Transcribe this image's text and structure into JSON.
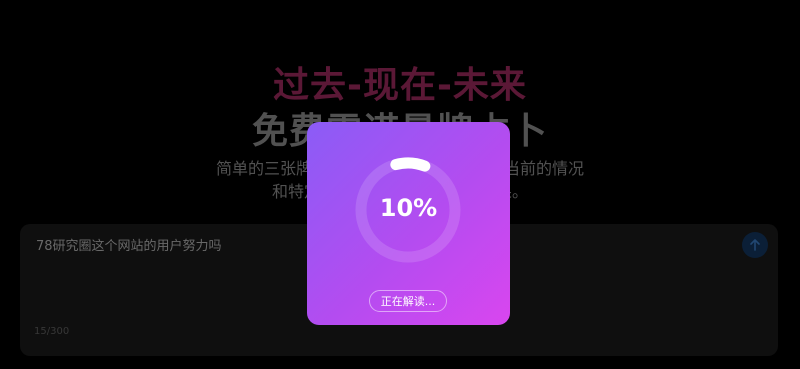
{
  "hero": {
    "title_line1": "过去-现在-未来",
    "title_line2": "免费雷诺曼牌占卜",
    "subtitle_line1": "简单的三张牌雷诺曼牌占卜，揭示过去、当前的情况",
    "subtitle_line2": "和特定问题的未来可能发生的结果。"
  },
  "input": {
    "question": "78研究圈这个网站的用户努力吗",
    "counter": "15/300"
  },
  "modal": {
    "progress_text": "10%",
    "progress_value": 0.1,
    "status_label": "正在解读..."
  },
  "colors": {
    "title_accent": "#7a2148",
    "modal_gradient_start": "#8b5cf6",
    "modal_gradient_end": "#d946ef"
  }
}
